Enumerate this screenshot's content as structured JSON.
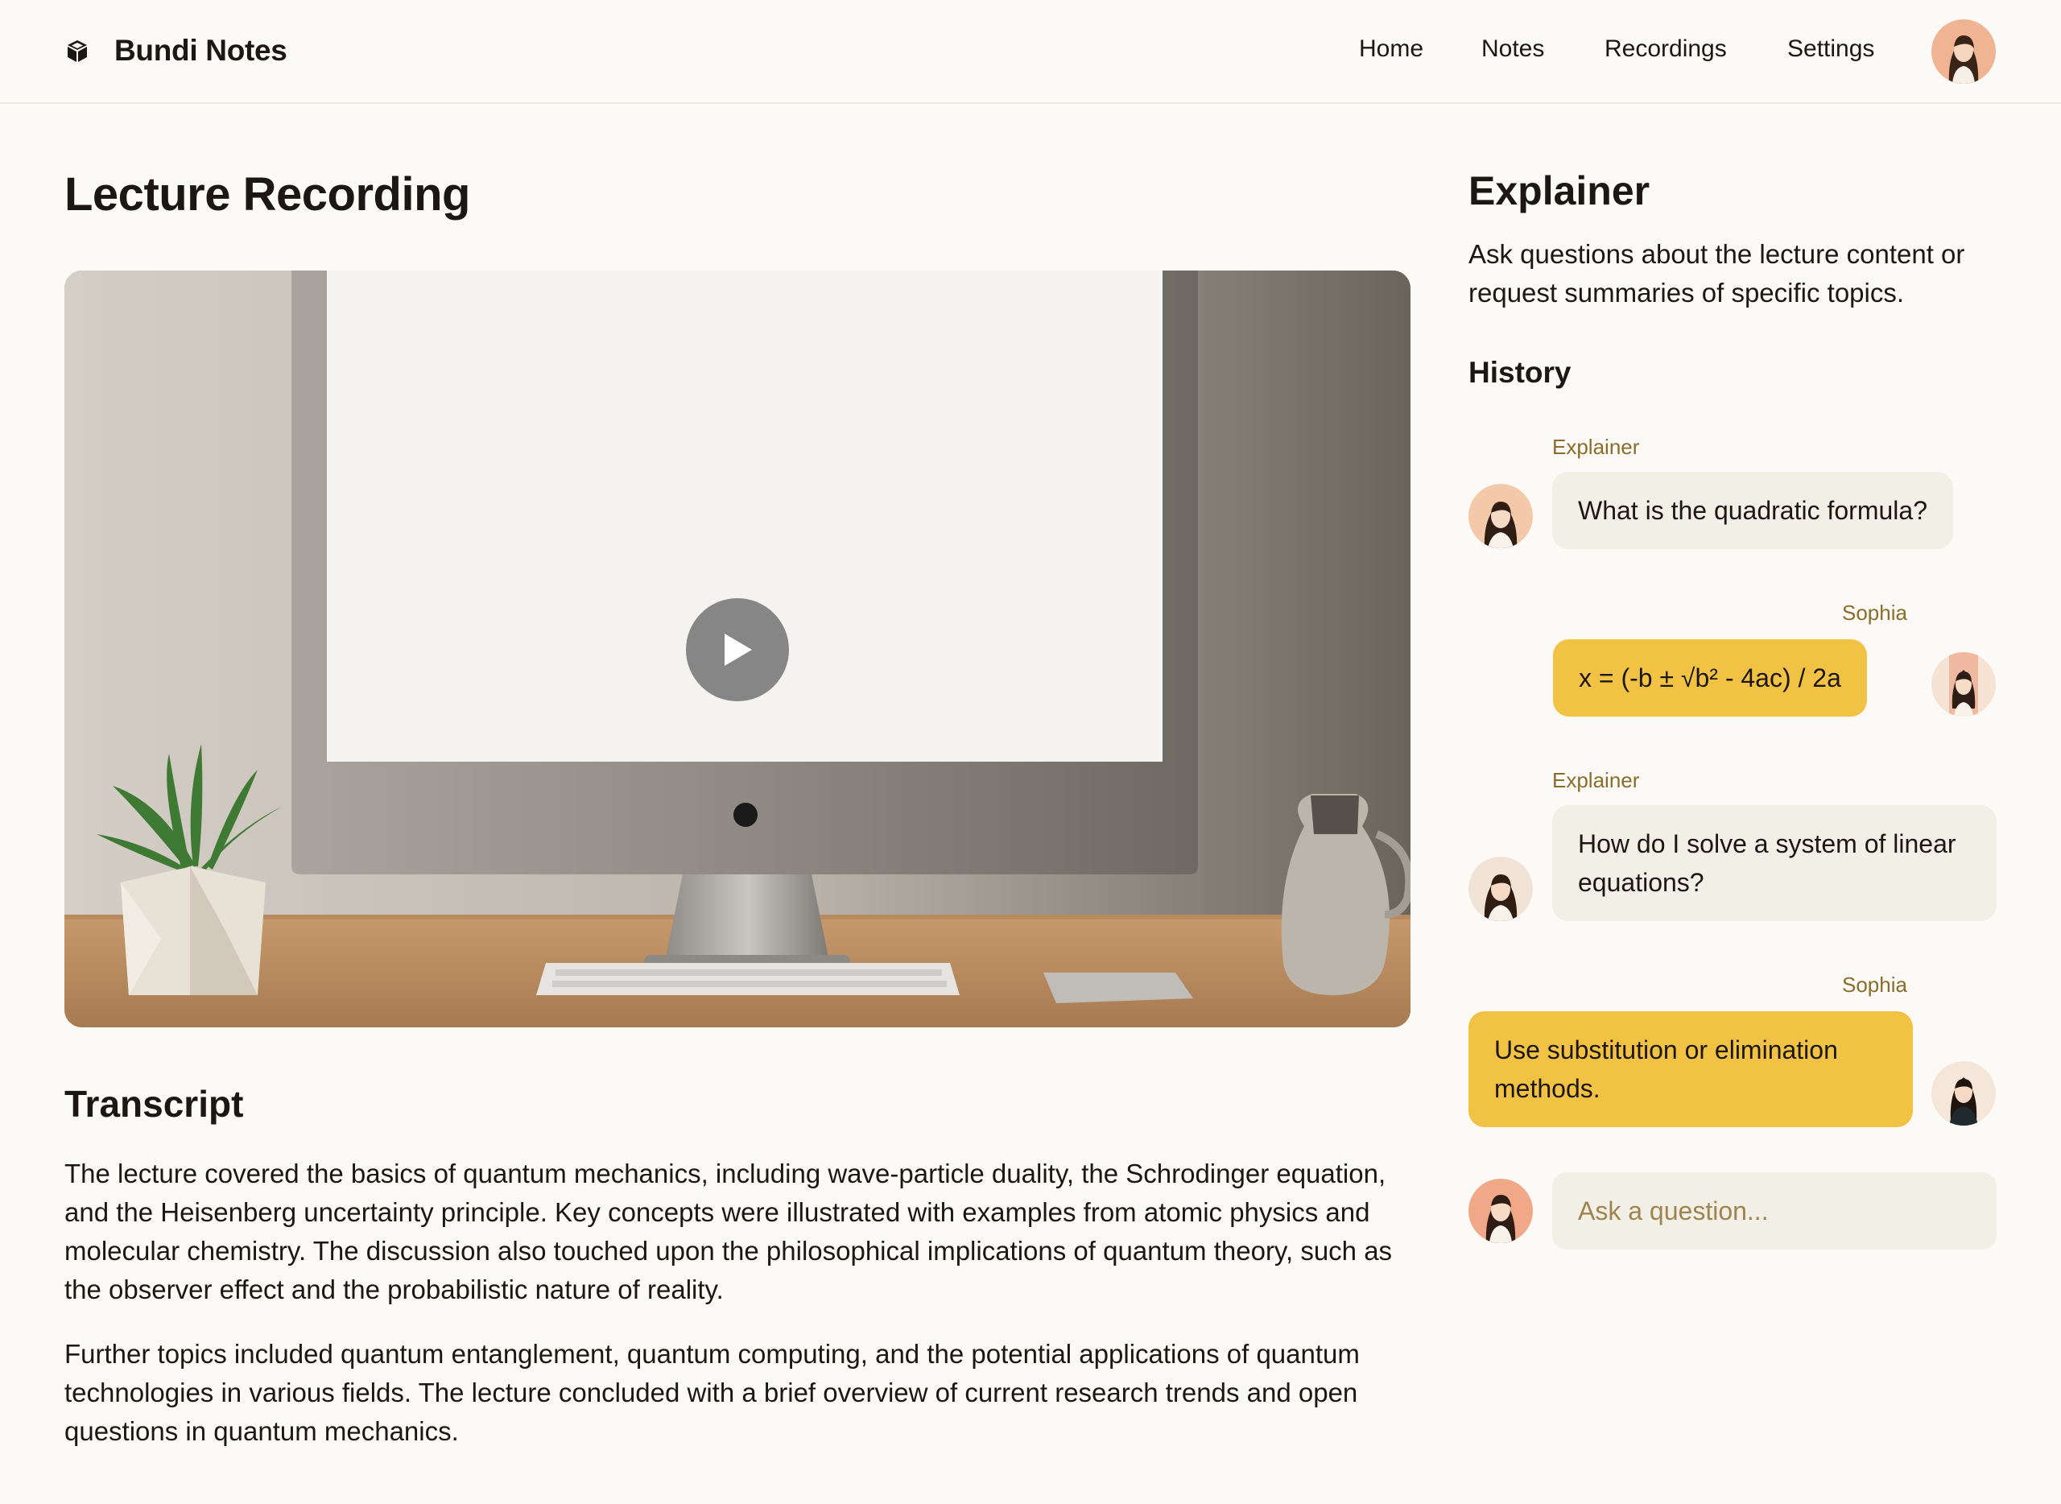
{
  "app": {
    "name": "Bundi Notes"
  },
  "nav": {
    "items": [
      "Home",
      "Notes",
      "Recordings",
      "Settings"
    ]
  },
  "main": {
    "title": "Lecture Recording",
    "transcript": {
      "heading": "Transcript",
      "paragraphs": [
        "The lecture covered the basics of quantum mechanics, including wave-particle duality, the Schrodinger equation, and the Heisenberg uncertainty principle. Key concepts were illustrated with examples from atomic physics and molecular chemistry. The discussion also touched upon the philosophical implications of quantum theory, such as the observer effect and the probabilistic nature of reality.",
        "Further topics included quantum entanglement, quantum computing, and the potential applications of quantum technologies in various fields. The lecture concluded with a brief overview of current research trends and open questions in quantum mechanics."
      ]
    }
  },
  "explainer": {
    "title": "Explainer",
    "description": "Ask questions about the lecture content or request summaries of specific topics.",
    "history_heading": "History",
    "messages": [
      {
        "sender": "Explainer",
        "text": "What is the quadratic formula?"
      },
      {
        "sender": "Sophia",
        "text": "x = (-b ± √b² - 4ac) / 2a"
      },
      {
        "sender": "Explainer",
        "text": "How do I solve a system of linear equations?"
      },
      {
        "sender": "Sophia",
        "text": "Use substitution or elimination methods."
      }
    ],
    "input": {
      "placeholder": "Ask a question..."
    }
  },
  "colors": {
    "background": "#fcfaf6",
    "bubble_gray": "#f2efe7",
    "bubble_yellow": "#f2c244",
    "sender_label": "#8a6d2c",
    "play_button": "#6e6e6e"
  },
  "icons": {
    "brand": "cube-icon",
    "video": "play-icon",
    "profile": "avatar"
  }
}
